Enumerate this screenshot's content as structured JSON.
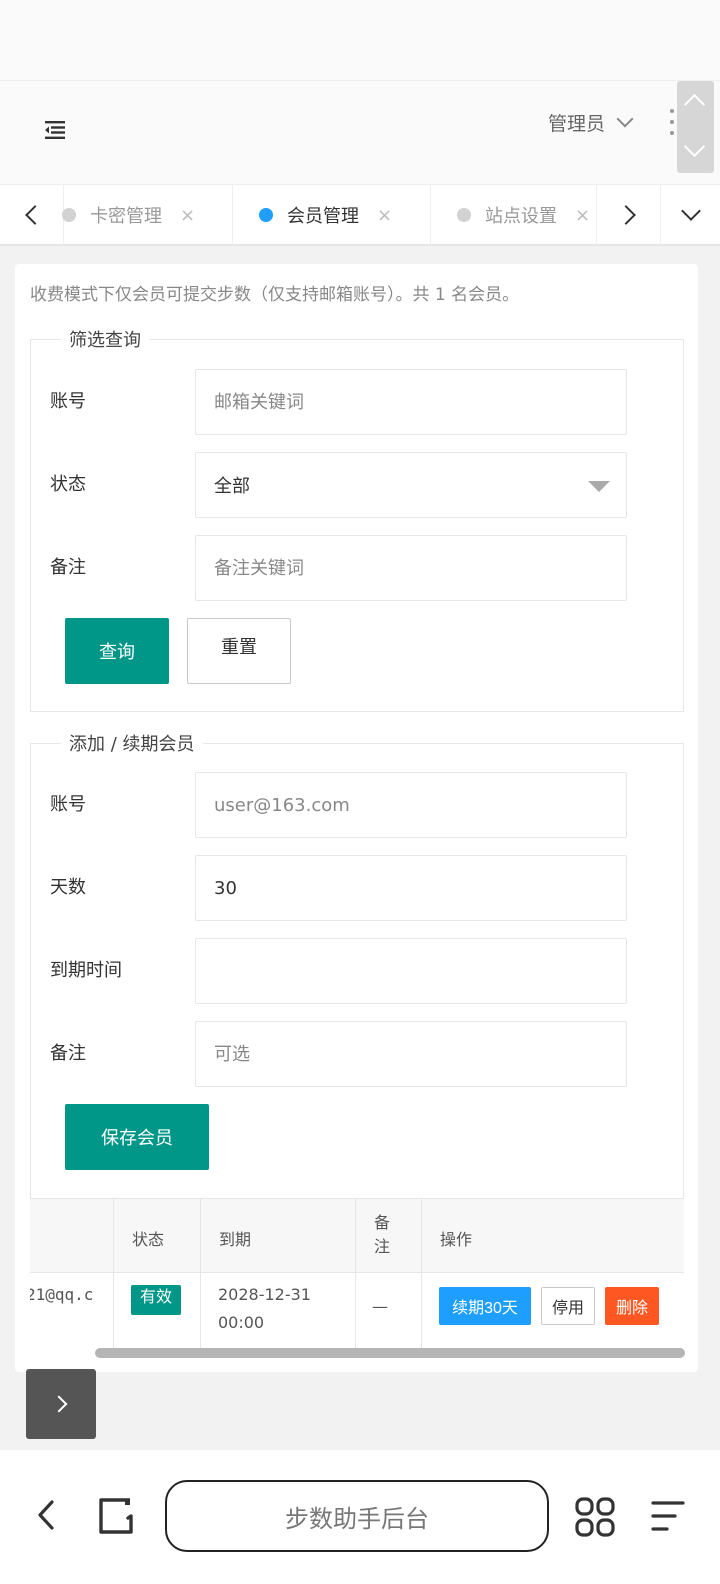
{
  "header": {
    "admin_label": "管理员"
  },
  "tabs": [
    {
      "label": "卡密管理",
      "close": "×"
    },
    {
      "label": "会员管理",
      "close": "×"
    },
    {
      "label": "站点设置",
      "close": "×"
    }
  ],
  "info": "收费模式下仅会员可提交步数（仅支持邮箱账号）。共 1 名会员。",
  "query": {
    "legend": "筛选查询",
    "account_label": "账号",
    "account_placeholder": "邮箱关键词",
    "status_label": "状态",
    "status_value": "全部",
    "remark_label": "备注",
    "remark_placeholder": "备注关键词",
    "search_button": "查询",
    "reset_button": "重置"
  },
  "add": {
    "legend": "添加 / 续期会员",
    "account_label": "账号",
    "account_placeholder": "user@163.com",
    "days_label": "天数",
    "days_value": "30",
    "expire_label": "到期时间",
    "expire_value": "",
    "remark_label": "备注",
    "remark_placeholder": "可选",
    "save_button": "保存会员"
  },
  "table": {
    "headers": {
      "status": "状态",
      "expire": "到期",
      "remark": "备\n注",
      "actions": "操作"
    },
    "rows": [
      {
        "account": "21@qq.c",
        "status": "有效",
        "expire": "2028-12-31\n00:00",
        "remark": "—",
        "renew_button": "续期30天",
        "disable_button": "停用",
        "delete_button": "删除"
      }
    ]
  },
  "browser": {
    "url_title": "步数助手后台"
  },
  "colors": {
    "primary": "#009688",
    "tab_active_dot": "#1e9fff",
    "renew": "#1e9fff",
    "delete": "#ff5722"
  }
}
